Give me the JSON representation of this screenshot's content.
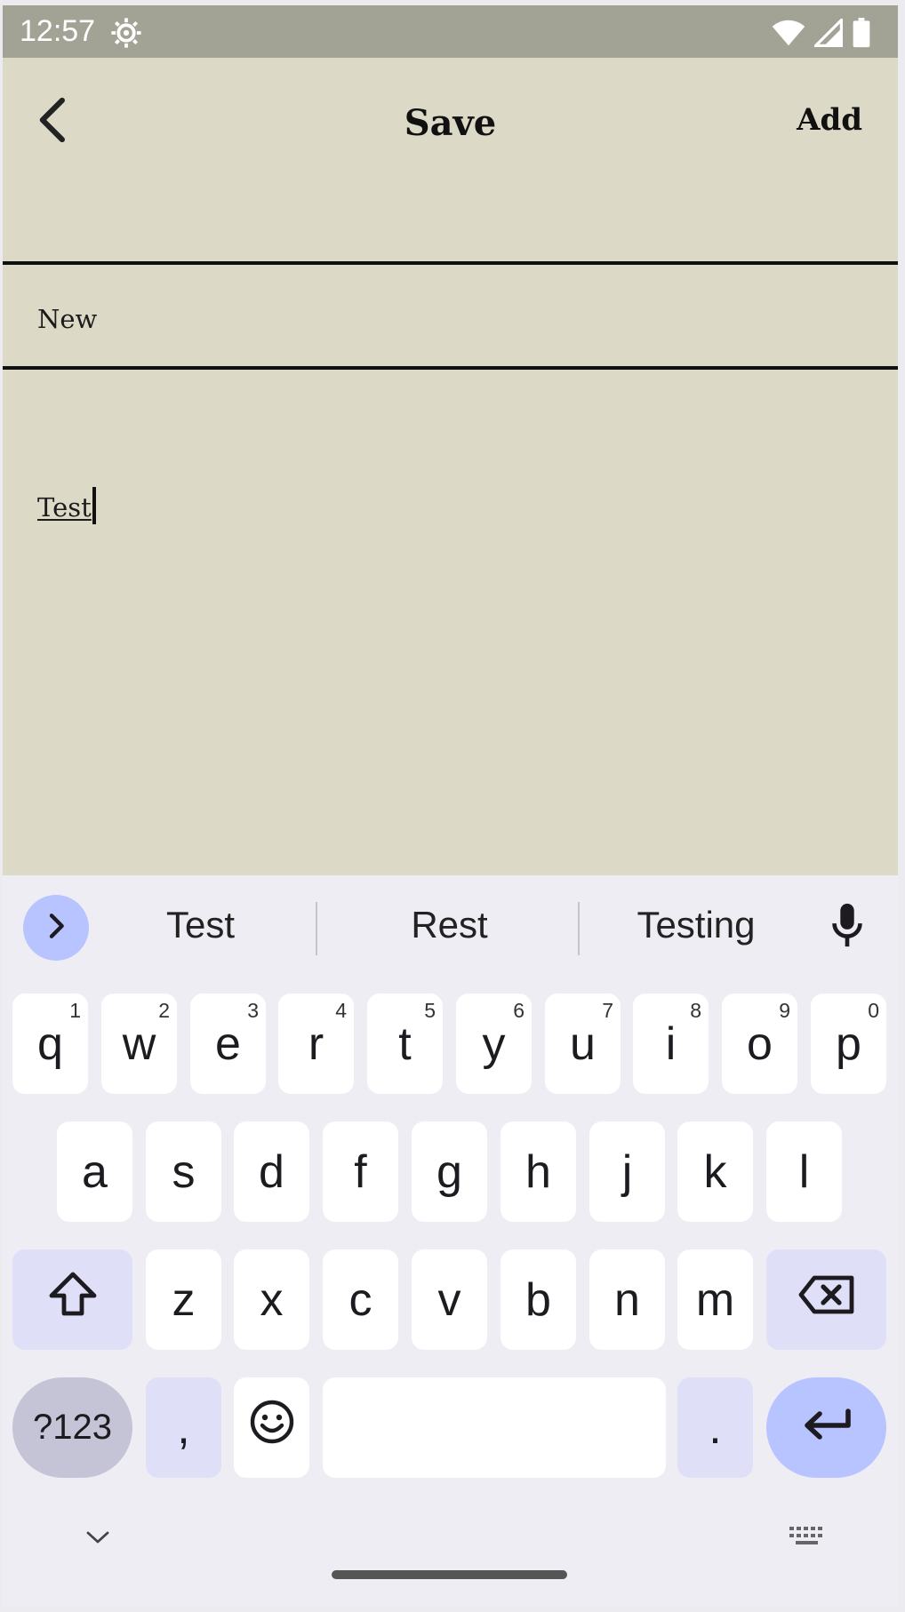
{
  "status_bar": {
    "time": "12:57",
    "icons": [
      "settings-gear-icon",
      "wifi-icon",
      "cellular-signal-icon",
      "battery-icon"
    ]
  },
  "app_bar": {
    "back_icon": "chevron-left-icon",
    "title": "Save",
    "action_label": "Add"
  },
  "note": {
    "title_value": "New",
    "body_value": "Test"
  },
  "keyboard": {
    "suggestions": [
      "Test",
      "Rest",
      "Testing"
    ],
    "row1": [
      {
        "key": "q",
        "hint": "1"
      },
      {
        "key": "w",
        "hint": "2"
      },
      {
        "key": "e",
        "hint": "3"
      },
      {
        "key": "r",
        "hint": "4"
      },
      {
        "key": "t",
        "hint": "5"
      },
      {
        "key": "y",
        "hint": "6"
      },
      {
        "key": "u",
        "hint": "7"
      },
      {
        "key": "i",
        "hint": "8"
      },
      {
        "key": "o",
        "hint": "9"
      },
      {
        "key": "p",
        "hint": "0"
      }
    ],
    "row2": [
      "a",
      "s",
      "d",
      "f",
      "g",
      "h",
      "j",
      "k",
      "l"
    ],
    "row3": [
      "z",
      "x",
      "c",
      "v",
      "b",
      "n",
      "m"
    ],
    "symbols_label": "?123",
    "comma_label": ",",
    "period_label": "."
  },
  "colors": {
    "app_background": "#dcdac6",
    "status_bar": "#a3a395",
    "keyboard_background": "#efedf4",
    "accent": "#b8c4ff"
  }
}
